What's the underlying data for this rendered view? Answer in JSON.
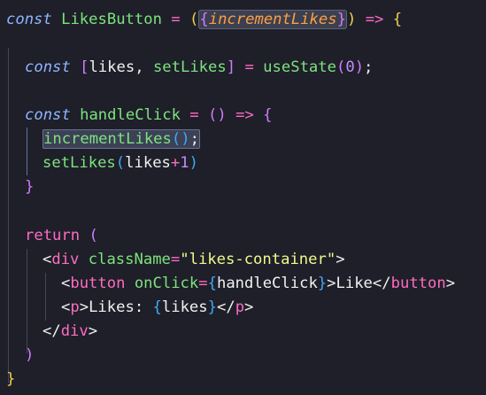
{
  "tokens": {
    "const": "const",
    "likes_button": "LikesButton",
    "eq": "=",
    "open_paren": "(",
    "close_paren": ")",
    "open_brace": "{",
    "close_brace": "}",
    "increment_likes": "incrementLikes",
    "arrow": "=>",
    "open_bracket": "[",
    "close_bracket": "]",
    "likes": "likes",
    "comma": ",",
    "set_likes": "setLikes",
    "use_state": "useState",
    "zero": "0",
    "semicolon": ";",
    "handle_click": "handleClick",
    "plus": "+",
    "one": "1",
    "return": "return",
    "lt": "<",
    "gt": ">",
    "lt_slash": "</",
    "div": "div",
    "class_name": "className",
    "likes_container": "\"likes-container\"",
    "button": "button",
    "on_click": "onClick",
    "like": "Like",
    "p": "p",
    "likes_label": "Likes: "
  }
}
